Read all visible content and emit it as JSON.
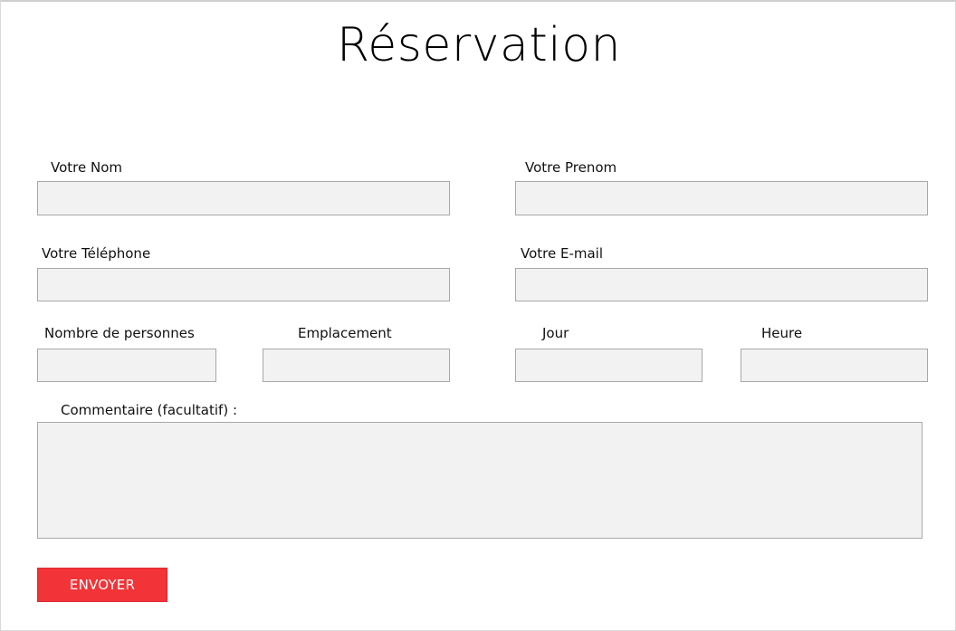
{
  "title": "Réservation",
  "form": {
    "last_name": {
      "label": "Votre Nom",
      "value": ""
    },
    "first_name": {
      "label": "Votre Prenom",
      "value": ""
    },
    "phone": {
      "label": "Votre Téléphone",
      "value": ""
    },
    "email": {
      "label": "Votre E-mail",
      "value": ""
    },
    "guests": {
      "label": "Nombre de personnes",
      "value": ""
    },
    "location": {
      "label": "Emplacement",
      "value": ""
    },
    "day": {
      "label": "Jour",
      "value": ""
    },
    "time": {
      "label": "Heure",
      "value": ""
    },
    "comment": {
      "label": "Commentaire (facultatif) :",
      "value": ""
    },
    "submit_label": "ENVOYER"
  },
  "colors": {
    "accent": "#f23338",
    "field_background": "#f2f2f2",
    "field_border": "#a8a8a8"
  }
}
